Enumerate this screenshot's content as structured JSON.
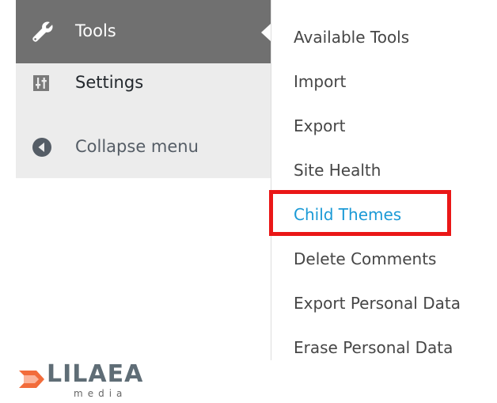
{
  "menu": {
    "tools_label": "Tools",
    "settings_label": "Settings",
    "collapse_label": "Collapse menu"
  },
  "submenu": {
    "items": [
      {
        "label": "Available Tools"
      },
      {
        "label": "Import"
      },
      {
        "label": "Export"
      },
      {
        "label": "Site Health"
      },
      {
        "label": "Child Themes"
      },
      {
        "label": "Delete Comments"
      },
      {
        "label": "Export Personal Data"
      },
      {
        "label": "Erase Personal Data"
      }
    ],
    "active_index": 4
  },
  "logo": {
    "name": "LILAEA",
    "sub": "media"
  },
  "colors": {
    "active_menu_bg": "#707070",
    "menu_bg": "#ececec",
    "link_active": "#1b9ad6",
    "highlight_border": "#ea1717",
    "logo_orange": "#f26c3b"
  },
  "icons": {
    "tools": "wrench-icon",
    "settings": "sliders-icon",
    "collapse": "collapse-arrow-icon"
  }
}
